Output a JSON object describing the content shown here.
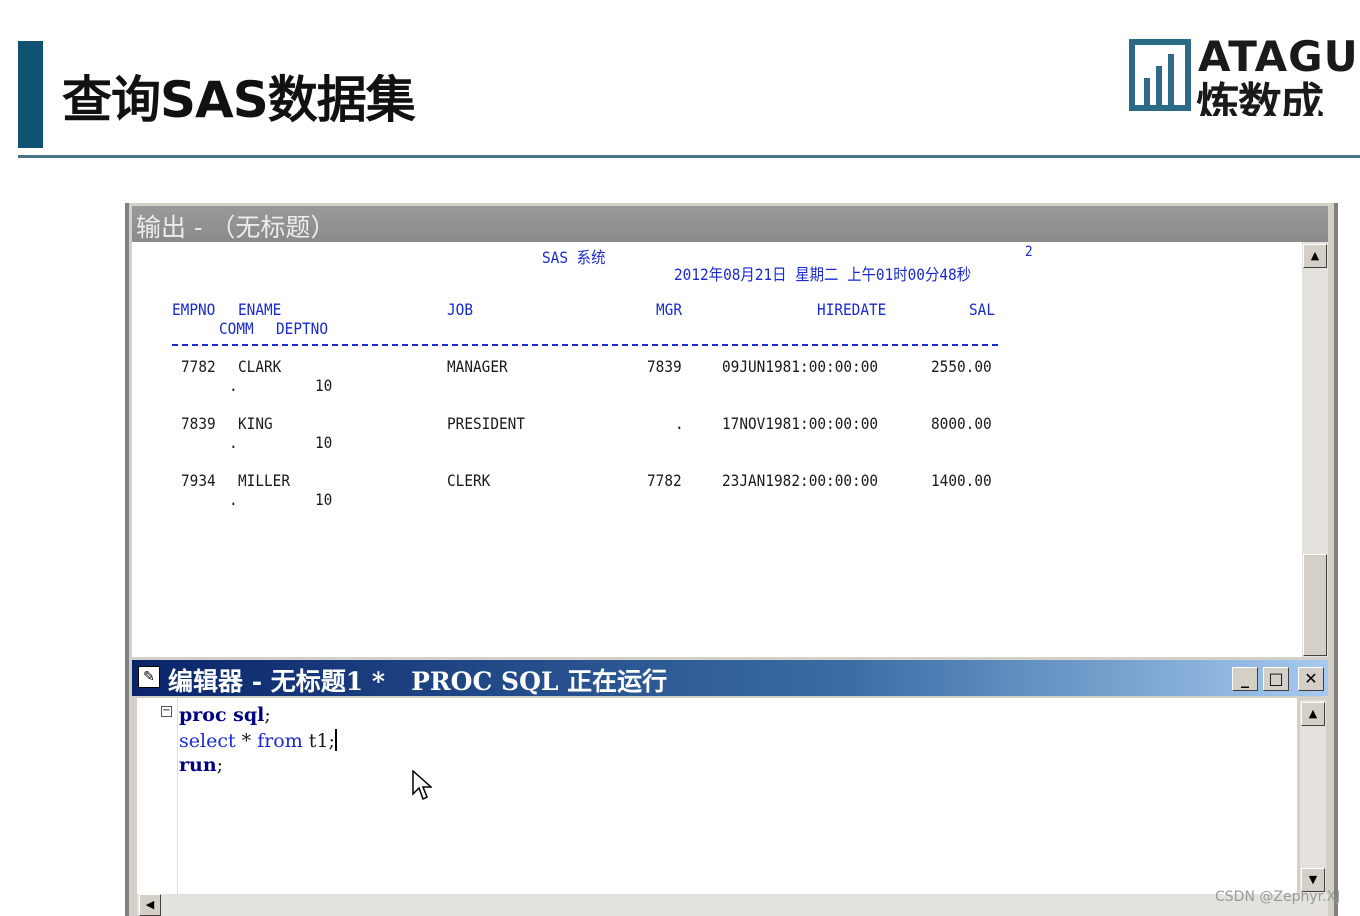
{
  "slide": {
    "title": "查询SAS数据集",
    "logo": {
      "line1": "ATAGU",
      "line2": "炼数成"
    }
  },
  "output_window": {
    "title": "输出 - （无标题）",
    "header": {
      "system": "SAS 系统",
      "page": "2",
      "datetime": "2012年08月21日 星期二 上午01时00分48秒"
    },
    "columns": {
      "empno": "EMPNO",
      "ename": "ENAME",
      "job": "JOB",
      "mgr": "MGR",
      "hiredate": "HIREDATE",
      "sal": "SAL",
      "comm": "COMM",
      "deptno": "DEPTNO"
    },
    "rows": [
      {
        "empno": "7782",
        "ename": "CLARK",
        "job": "MANAGER",
        "mgr": "7839",
        "hiredate": "09JUN1981:00:00:00",
        "sal": "2550.00",
        "comm": ".",
        "deptno": "10"
      },
      {
        "empno": "7839",
        "ename": "KING",
        "job": "PRESIDENT",
        "mgr": ".",
        "hiredate": "17NOV1981:00:00:00",
        "sal": "8000.00",
        "comm": ".",
        "deptno": "10"
      },
      {
        "empno": "7934",
        "ename": "MILLER",
        "job": "CLERK",
        "mgr": "7782",
        "hiredate": "23JAN1982:00:00:00",
        "sal": "1400.00",
        "comm": ".",
        "deptno": "10"
      }
    ]
  },
  "editor_window": {
    "title": "编辑器 - 无标题1 *",
    "status": "PROC SQL 正在运行",
    "code": {
      "line1_kw": "proc sql",
      "line1_end": ";",
      "line2_select": "select",
      "line2_mid": " * ",
      "line2_from": "from",
      "line2_end": " t1;",
      "line3_kw": "run",
      "line3_end": ";"
    },
    "buttons": {
      "minimize": "_",
      "maximize": "□",
      "close": "✕"
    }
  },
  "watermark": "CSDN @Zephyr.XJ"
}
